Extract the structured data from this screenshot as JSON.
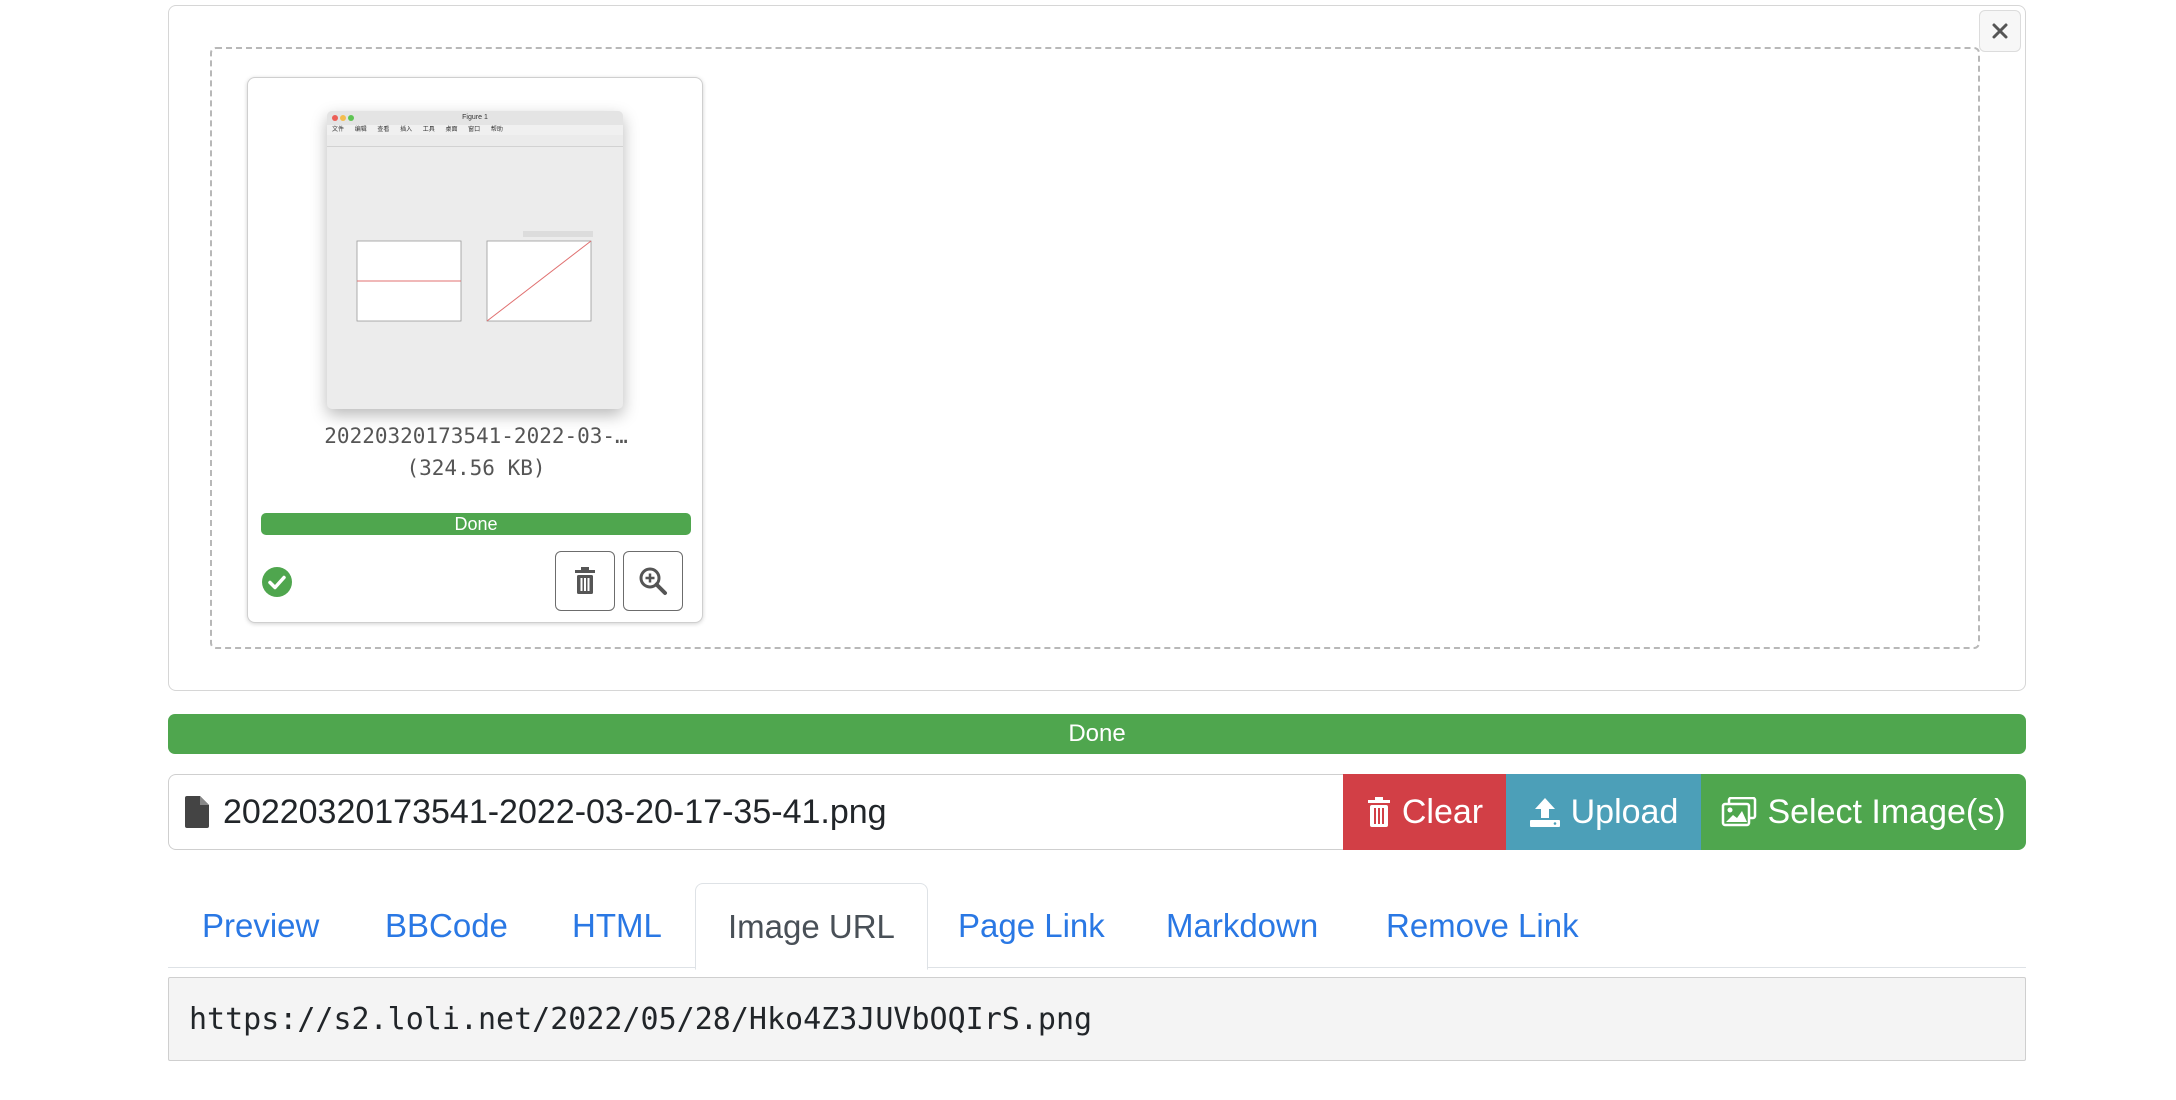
{
  "upload": {
    "close_icon": "close-icon",
    "file": {
      "name_truncated": "20220320173541-2022-03-…",
      "size": "(324.56 KB)",
      "status": "Done",
      "thumbnail_title": "Figure 1",
      "thumbnail_menu": [
        "文件",
        "编辑",
        "查看",
        "插入",
        "工具",
        "桌面",
        "窗口",
        "帮助"
      ]
    },
    "overall_status": "Done"
  },
  "input_group": {
    "file_icon": "file-icon",
    "filename": "20220320173541-2022-03-20-17-35-41.png",
    "clear_label": "Clear",
    "upload_label": "Upload",
    "select_label": "Select Image(s)"
  },
  "tabs": [
    {
      "label": "Preview"
    },
    {
      "label": "BBCode"
    },
    {
      "label": "HTML"
    },
    {
      "label": "Image URL",
      "active": true
    },
    {
      "label": "Page Link"
    },
    {
      "label": "Markdown"
    },
    {
      "label": "Remove Link"
    }
  ],
  "output": {
    "url": "https://s2.loli.net/2022/05/28/Hko4Z3JUVbOQIrS.png"
  },
  "colors": {
    "success": "#4fa64e",
    "danger": "#d23f46",
    "info": "#4c9fb8",
    "link": "#2a78e4"
  }
}
